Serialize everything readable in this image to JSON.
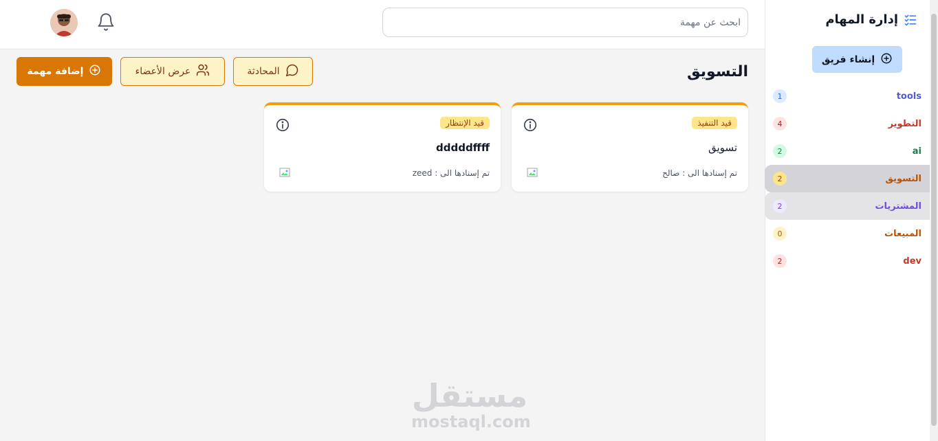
{
  "sidebar": {
    "title": "إدارة المهام",
    "create_team_label": "إنشاء فريق",
    "teams": [
      {
        "label": "tools",
        "count": "1",
        "color": "#4f5bd5",
        "badge_bg": "#dbeafe",
        "badge_fg": "#2563eb"
      },
      {
        "label": "التطوير",
        "count": "4",
        "color": "#c0392b",
        "badge_bg": "#fee2e2",
        "badge_fg": "#b91c1c"
      },
      {
        "label": "ai",
        "count": "2",
        "color": "#1f7a4d",
        "badge_bg": "#d1fae5",
        "badge_fg": "#15803d"
      },
      {
        "label": "التسويق",
        "count": "2",
        "color": "#b45309",
        "badge_bg": "#fde68a",
        "badge_fg": "#92400e"
      },
      {
        "label": "المشتريات",
        "count": "2",
        "color": "#6d4ed8",
        "badge_bg": "#ede9fe",
        "badge_fg": "#7c3aed"
      },
      {
        "label": "المبيعات",
        "count": "0",
        "color": "#b45309",
        "badge_bg": "#fef3c7",
        "badge_fg": "#b45309"
      },
      {
        "label": "dev",
        "count": "2",
        "color": "#c0392b",
        "badge_bg": "#fee2e2",
        "badge_fg": "#b91c1c"
      }
    ]
  },
  "header": {
    "search_placeholder": "ابحث عن مهمة"
  },
  "main": {
    "page_title": "التسويق",
    "buttons": {
      "chat": "المحادثة",
      "members": "عرض الأعضاء",
      "add_task": "إضافة مهمة"
    },
    "cards": [
      {
        "status": "قيد التنفيذ",
        "title": "تسويق",
        "assigned": "تم إسنادها الى : صالح"
      },
      {
        "status": "قيد الإنتظار",
        "title": "dddddffff",
        "assigned": "تم إسنادها الى : zeed"
      }
    ]
  },
  "watermark": {
    "arabic": "مستقل",
    "latin": "mostaql.com"
  },
  "colors": {
    "accent": "#d97706",
    "accent_light": "#fef3c7",
    "card_border": "#f59e0b"
  }
}
